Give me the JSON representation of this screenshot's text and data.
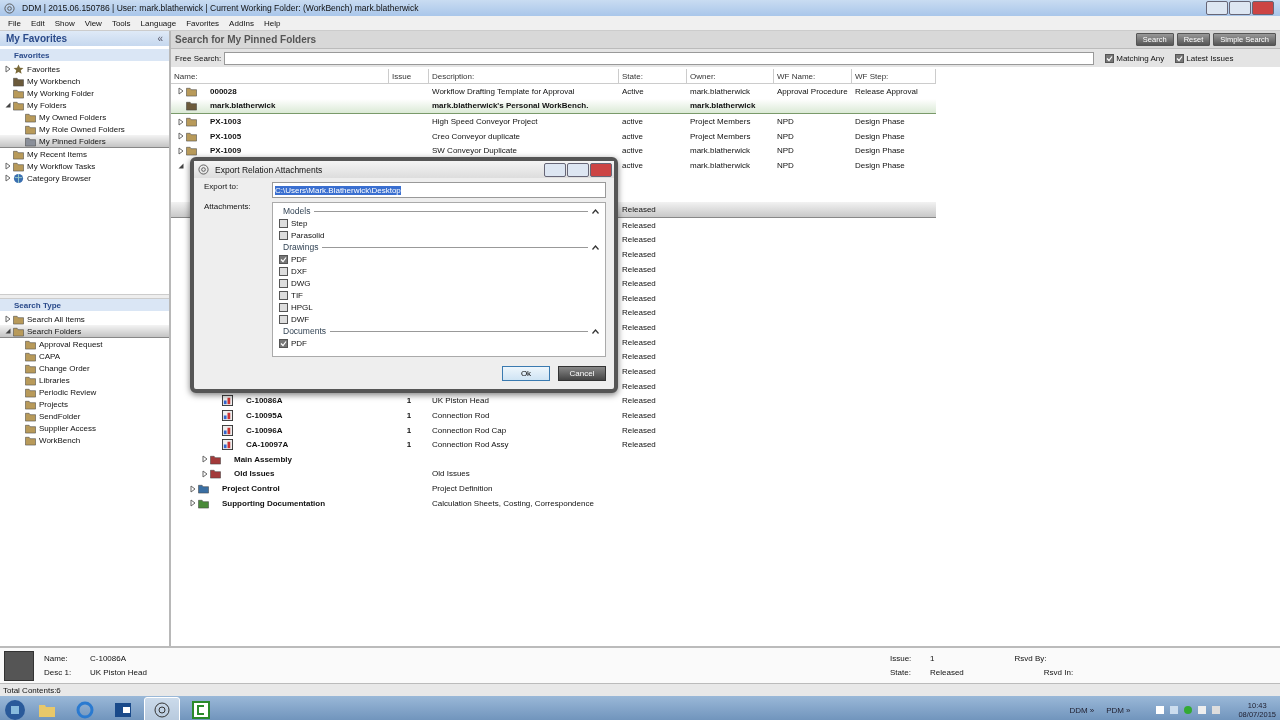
{
  "window": {
    "title": "DDM | 2015.06.150786 | User: mark.blatherwick | Current Working Folder: (WorkBench) mark.blatherwick"
  },
  "menu": [
    "File",
    "Edit",
    "Show",
    "View",
    "Tools",
    "Language",
    "Favorites",
    "AddIns",
    "Help"
  ],
  "sidebar": {
    "title": "My Favorites",
    "collapse": "«",
    "section": "Favorites",
    "items": [
      {
        "label": "Favorites",
        "kind": "star",
        "expanded": false,
        "selected": false
      },
      {
        "label": "My Workbench",
        "kind": "workbench",
        "selected": false
      },
      {
        "label": "My Working Folder",
        "kind": "folder",
        "selected": false
      },
      {
        "label": "My Folders",
        "kind": "folder",
        "expanded": true,
        "selected": false,
        "children": [
          {
            "label": "My Owned Folders",
            "kind": "folder",
            "selected": false
          },
          {
            "label": "My Role Owned Folders",
            "kind": "folder",
            "selected": false
          },
          {
            "label": "My Pinned Folders",
            "kind": "pin",
            "selected": true
          }
        ]
      },
      {
        "label": "My Recent Items",
        "kind": "folder",
        "selected": false
      },
      {
        "label": "My Workflow Tasks",
        "kind": "folder",
        "expanded": false,
        "selected": false
      },
      {
        "label": "Category Browser",
        "kind": "globe",
        "expanded": false,
        "selected": false
      }
    ],
    "search_section": "Search Type",
    "search_items": [
      {
        "label": "Search All Items",
        "kind": "folder",
        "expanded": false,
        "selected": false
      },
      {
        "label": "Search Folders",
        "kind": "folder",
        "expanded": true,
        "selected": true,
        "children": [
          {
            "label": "Approval Request",
            "kind": "folder",
            "selected": false
          },
          {
            "label": "CAPA",
            "kind": "folder",
            "selected": false
          },
          {
            "label": "Change Order",
            "kind": "folder",
            "selected": false
          },
          {
            "label": "Libraries",
            "kind": "folder",
            "selected": false
          },
          {
            "label": "Periodic Review",
            "kind": "folder",
            "selected": false
          },
          {
            "label": "Projects",
            "kind": "folder",
            "selected": false
          },
          {
            "label": "SendFolder",
            "kind": "folder",
            "selected": false
          },
          {
            "label": "Supplier Access",
            "kind": "folder",
            "selected": false
          },
          {
            "label": "WorkBench",
            "kind": "folder",
            "selected": false
          }
        ]
      }
    ]
  },
  "main": {
    "title": "Search for My Pinned Folders",
    "buttons": [
      "Search",
      "Reset",
      "Simple Search"
    ],
    "free_search": {
      "label": "Free Search:"
    },
    "options": [
      {
        "label": "Matching Any",
        "checked": true
      },
      {
        "label": "Latest Issues",
        "checked": true
      }
    ],
    "columns": [
      "Name:",
      "Issue",
      "Description:",
      "State:",
      "Owner:",
      "WF Name:",
      "WF Step:"
    ],
    "rows": [
      {
        "name": "000028",
        "kind": "folder",
        "expanded": false,
        "selected": false,
        "current": false,
        "description": "Workflow Drafting Template for Approval",
        "state": "Active",
        "owner": "mark.blatherwick",
        "wf_name": "Approval Procedure",
        "wf_step": "Release Approval"
      },
      {
        "name": "mark.blatherwick",
        "kind": "workbench",
        "selected": false,
        "current": true,
        "description": "mark.blatherwick's Personal WorkBench.",
        "owner": "mark.blatherwick"
      },
      {
        "name": "PX-1003",
        "kind": "folder",
        "expanded": false,
        "selected": false,
        "current": false,
        "description": "High Speed Conveyor Project",
        "state": "active",
        "owner": "Project Members",
        "wf_name": "NPD",
        "wf_step": "Design Phase"
      },
      {
        "name": "PX-1005",
        "kind": "folder",
        "expanded": false,
        "selected": false,
        "current": false,
        "description": "Creo Conveyor duplicate",
        "state": "active",
        "owner": "Project Members",
        "wf_name": "NPD",
        "wf_step": "Design Phase"
      },
      {
        "name": "PX-1009",
        "kind": "folder",
        "expanded": false,
        "selected": false,
        "current": false,
        "description": "SW Conveyor Duplicate",
        "state": "active",
        "owner": "mark.blatherwick",
        "wf_name": "NPD",
        "wf_step": "Design Phase"
      },
      {
        "expanded": true,
        "selected": false,
        "current": false,
        "state": "active",
        "owner": "mark.blatherwick",
        "wf_name": "NPD",
        "wf_step": "Design Phase",
        "children": [
          {
            "selected": false,
            "current": false,
            "children": [
              {
                "selected": false,
                "current": false,
                "children": [
                  {
                    "state": "Released",
                    "selected": true,
                    "current": false
                  },
                  {
                    "state": "Released",
                    "selected": false,
                    "current": false
                  },
                  {
                    "state": "Released",
                    "selected": false,
                    "current": false
                  },
                  {
                    "state": "Released",
                    "selected": false,
                    "current": false
                  },
                  {
                    "state": "Released",
                    "selected": false,
                    "current": false
                  },
                  {
                    "state": "Released",
                    "selected": false,
                    "current": false
                  },
                  {
                    "state": "Released",
                    "selected": false,
                    "current": false
                  },
                  {
                    "state": "Released",
                    "selected": false,
                    "current": false
                  },
                  {
                    "state": "Released",
                    "selected": false,
                    "current": false
                  },
                  {
                    "state": "Released",
                    "selected": false,
                    "current": false
                  },
                  {
                    "state": "Released",
                    "selected": false,
                    "current": false
                  },
                  {
                    "state": "Released",
                    "selected": false,
                    "current": false
                  },
                  {
                    "state": "Released",
                    "selected": false,
                    "current": false
                  },
                  {
                    "name": "C-10086A",
                    "kind": "part",
                    "issue": "1",
                    "description": "UK Piston Head",
                    "state": "Released",
                    "selected": false,
                    "current": false
                  },
                  {
                    "name": "C-10095A",
                    "kind": "part",
                    "issue": "1",
                    "description": "Connection Rod",
                    "state": "Released",
                    "selected": false,
                    "current": false
                  },
                  {
                    "name": "C-10096A",
                    "kind": "part",
                    "issue": "1",
                    "description": "Connection Rod Cap",
                    "state": "Released",
                    "selected": false,
                    "current": false
                  },
                  {
                    "name": "CA-10097A",
                    "kind": "part",
                    "issue": "1",
                    "description": "Connection Rod Assy",
                    "state": "Released",
                    "selected": false,
                    "current": false
                  }
                ]
              },
              {
                "name": "Main Assembly",
                "kind": "red-folder",
                "expanded": false,
                "selected": false,
                "current": false
              },
              {
                "name": "Old Issues",
                "kind": "red-folder",
                "expanded": false,
                "selected": false,
                "current": false,
                "description": "Old Issues"
              }
            ]
          },
          {
            "name": "Project Control",
            "kind": "blue-folder",
            "expanded": false,
            "selected": false,
            "current": false,
            "description": "Project Definition"
          },
          {
            "name": "Supporting Documentation",
            "kind": "green-folder",
            "expanded": false,
            "selected": false,
            "current": false,
            "description": "Calculation Sheets, Costing, Correspondence"
          }
        ]
      }
    ]
  },
  "dialog": {
    "title": "Export Relation Attachments",
    "export_label": "Export to:",
    "export_value": "C:\\Users\\Mark.Blatherwick\\Desktop",
    "attachments_label": "Attachments:",
    "groups": [
      {
        "title": "Models",
        "expanded": true,
        "items": [
          {
            "label": "Step",
            "checked": false
          },
          {
            "label": "Parasolid",
            "checked": false
          }
        ]
      },
      {
        "title": "Drawings",
        "expanded": true,
        "items": [
          {
            "label": "PDF",
            "checked": true
          },
          {
            "label": "DXF",
            "checked": false
          },
          {
            "label": "DWG",
            "checked": false
          },
          {
            "label": "TIF",
            "checked": false
          },
          {
            "label": "HPGL",
            "checked": false
          },
          {
            "label": "DWF",
            "checked": false
          }
        ]
      },
      {
        "title": "Documents",
        "expanded": true,
        "items": [
          {
            "label": "PDF",
            "checked": true
          }
        ]
      }
    ],
    "buttons": [
      "Ok",
      "Cancel"
    ]
  },
  "details": {
    "fields_left": [
      {
        "label": "Name:",
        "value": "C-10086A"
      },
      {
        "label": "Desc 1:",
        "value": "UK Piston Head"
      }
    ],
    "fields_mid": [
      {
        "label": "Issue:",
        "value": "1"
      },
      {
        "label": "State:",
        "value": "Released"
      }
    ],
    "fields_right": [
      {
        "label": "Rsvd By:"
      },
      {
        "label": "Rsvd In:"
      }
    ]
  },
  "status_bar": "Total Contents:6",
  "taskbar": {
    "toolbars": [
      {
        "label": "DDM",
        "chevron": "»"
      },
      {
        "label": "PDM",
        "chevron": "»"
      }
    ],
    "time": "10:43",
    "date": "08/07/2015"
  }
}
